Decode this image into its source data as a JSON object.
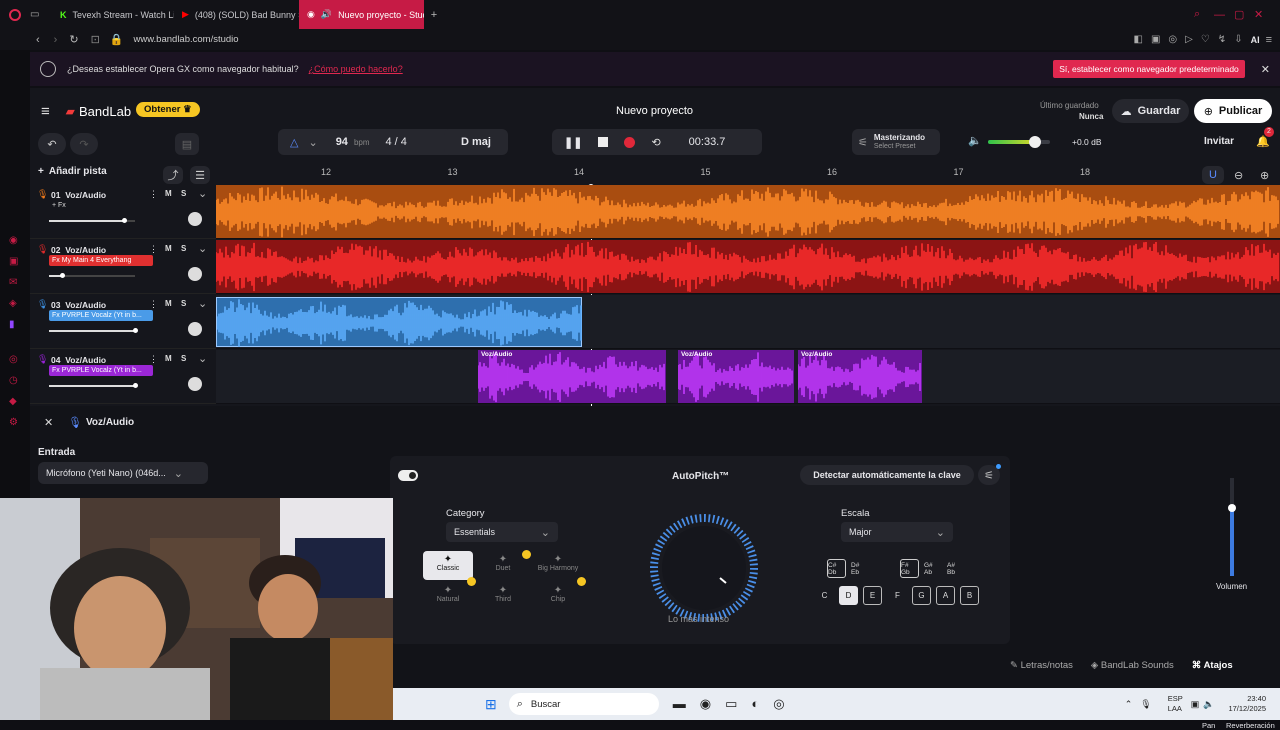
{
  "browser": {
    "tabs": [
      {
        "label": "Tevexh Stream - Watch Liv",
        "icon": "kick-icon",
        "active": false
      },
      {
        "label": "(408) (SOLD) Bad Bunny ×",
        "icon": "youtube-icon",
        "active": false
      },
      {
        "label": "Nuevo proyecto - Studi",
        "icon": "bandlab-icon",
        "active": true
      }
    ],
    "url": "www.bandlab.com/studio",
    "notice_text": "¿Deseas establecer Opera GX como navegador habitual?",
    "notice_link": "¿Cómo puedo hacerlo?",
    "notice_button": "Sí, establecer como navegador predeterminado",
    "ai_label": "AI"
  },
  "header": {
    "logo": "BandLab",
    "obtener": "Obtener",
    "project_title": "Nuevo proyecto",
    "last_saved_label": "Último guardado",
    "last_saved_value": "Nunca",
    "save": "Guardar",
    "publish": "Publicar"
  },
  "transport": {
    "bpm": "94",
    "bpm_unit": "bpm",
    "time_sig": "4 / 4",
    "key": "D maj",
    "time": "00:33.7",
    "mastering_title": "Masterizando",
    "mastering_sub": "Select Preset",
    "master_db": "+0.0 dB",
    "master_volume": 0.75,
    "invite": "Invitar",
    "notifications": "2"
  },
  "ruler": {
    "bars": [
      "12",
      "13",
      "14",
      "15",
      "16",
      "17",
      "18"
    ]
  },
  "add_track": "Añadir pista",
  "tracks": [
    {
      "num": "01",
      "name": "Voz/Audio",
      "fx": "+ Fx",
      "fx_color": "",
      "color": "#f07a1a",
      "vol": 0.87
    },
    {
      "num": "02",
      "name": "Voz/Audio",
      "fx": "Fx My Main 4 Everythang",
      "fx_color": "#e03030",
      "color": "#e02a2a",
      "vol": 0.15
    },
    {
      "num": "03",
      "name": "Voz/Audio",
      "fx": "Fx PVRPLE Vocalz (Yt in b...",
      "fx_color": "#4a9be8",
      "color": "#3d8fe0",
      "vol": 1.0
    },
    {
      "num": "04",
      "name": "Voz/Audio",
      "fx": "Fx PVRPLE Vocalz (Yt in b...",
      "fx_color": "#9b27d6",
      "color": "#9a22d8",
      "vol": 1.0
    }
  ],
  "ms": {
    "m": "M",
    "s": "S"
  },
  "clip_label": "Voz/Audio",
  "panel": {
    "track_label": "Voz/Audio",
    "input_label": "Entrada",
    "input_value": "Micrófono (Yeti Nano) (046d..."
  },
  "autopitch": {
    "title": "AutoPitch™",
    "detect": "Detectar automáticamente la clave",
    "category_label": "Category",
    "category_value": "Essentials",
    "presets": [
      {
        "label": "Classic",
        "icon": "sparkle-icon"
      },
      {
        "label": "Duet",
        "icon": "duet-icon"
      },
      {
        "label": "Big Harmony",
        "icon": "harmony-icon"
      },
      {
        "label": "Natural",
        "icon": "natural-icon"
      },
      {
        "label": "Third",
        "icon": "third-icon"
      },
      {
        "label": "Chip",
        "icon": "chip-icon"
      }
    ],
    "knob_label": "Lo más intenso",
    "scale_label": "Escala",
    "scale_value": "Major",
    "sharps": [
      "C# Db",
      "D# Eb",
      "F# Gb",
      "G# Ab",
      "A# Bb"
    ],
    "naturals": [
      "C",
      "D",
      "E",
      "F",
      "G",
      "A",
      "B"
    ]
  },
  "right_panel": {
    "volume": "Volumen",
    "pan": "Pan",
    "reverb": "Reverberación"
  },
  "footer": {
    "lyrics": "Letras/notas",
    "sounds": "BandLab Sounds",
    "shortcuts": "Atajos"
  },
  "taskbar": {
    "search": "Buscar",
    "lang1": "ESP",
    "lang2": "LAA",
    "time": "23:40",
    "date": "17/12/2025"
  }
}
